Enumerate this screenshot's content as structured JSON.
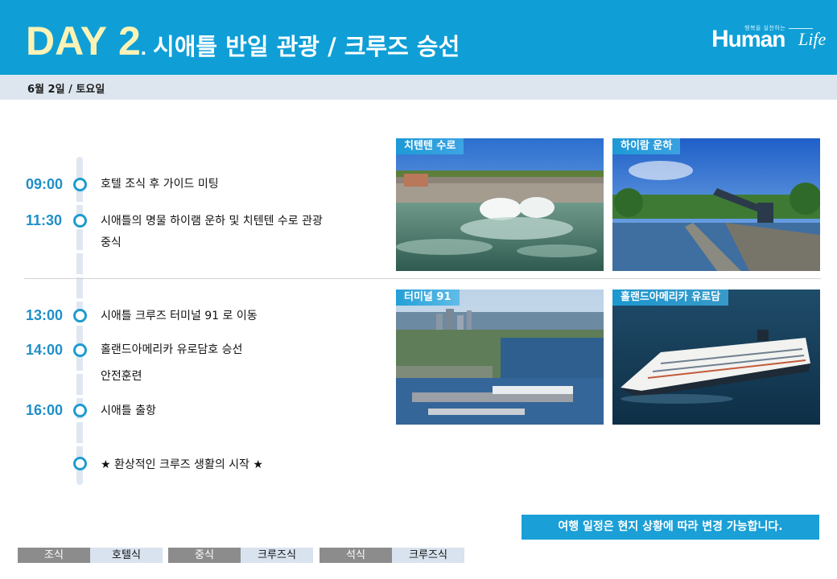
{
  "header": {
    "day_label": "DAY",
    "day_number": "2",
    "day_dot": ".",
    "title": "시애틀 반일 관광 / 크루즈 승선",
    "logo": {
      "sub": "행복을 실천하는",
      "main_h": "H",
      "main_rest": "uman",
      "script": "Life"
    }
  },
  "date": "6월 2일 / 토요일",
  "timeline": [
    {
      "time": "09:00",
      "lines": [
        "호텔 조식 후 가이드 미팅"
      ]
    },
    {
      "time": "11:30",
      "lines": [
        "시애틀의 명물 하이램 운하 및 치텐텐 수로 관광",
        "중식"
      ]
    },
    {
      "time": "13:00",
      "lines": [
        "시애틀 크루즈 터미널 91 로 이동"
      ]
    },
    {
      "time": "14:00",
      "lines": [
        "홀랜드아메리카 유로담호 승선",
        "안전훈련"
      ]
    },
    {
      "time": "16:00",
      "lines": [
        "시애틀 출항"
      ]
    },
    {
      "time": "",
      "lines": [
        "★ 환상적인 크루즈 생활의 시작 ★"
      ]
    }
  ],
  "photos": [
    {
      "caption": "치텐텐 수로",
      "icon": "locks-spillway-photo"
    },
    {
      "caption": "하이람 운하",
      "icon": "canal-bridge-photo"
    },
    {
      "caption": "터미널 91",
      "icon": "seattle-terminal-photo"
    },
    {
      "caption": "홀랜드아메리카 유로담",
      "icon": "cruise-ship-photo"
    }
  ],
  "notice": "여행 일정은 현지 상황에 따라 변경 가능합니다.",
  "meals": [
    {
      "label": "조식",
      "value": "호텔식"
    },
    {
      "label": "중식",
      "value": "크루즈식"
    },
    {
      "label": "석식",
      "value": "크루즈식"
    }
  ],
  "colors": {
    "header": "#0f9fd6",
    "day_text": "#fbf3b6",
    "time": "#1f8fc7",
    "date_bar": "#dde6ef",
    "notice": "#1a9fd6"
  }
}
